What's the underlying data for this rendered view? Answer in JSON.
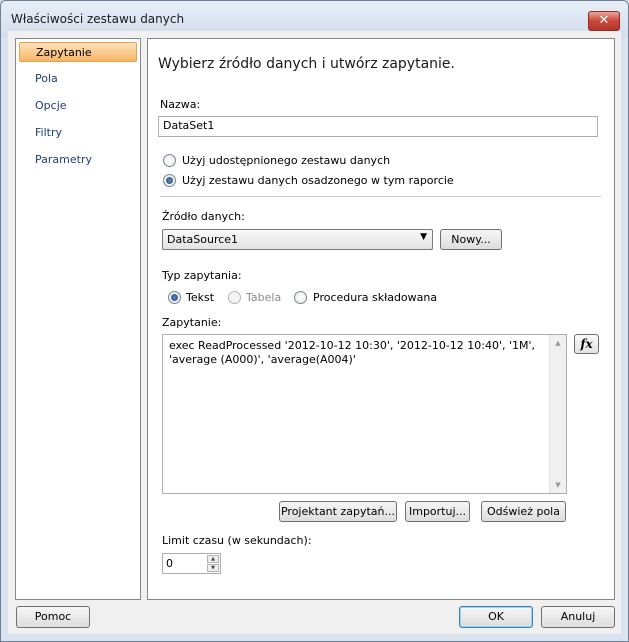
{
  "window": {
    "title": "Właściwości zestawu danych",
    "close_glyph": "✕"
  },
  "nav": {
    "items": [
      {
        "label": "Zapytanie",
        "selected": true
      },
      {
        "label": "Pola",
        "selected": false
      },
      {
        "label": "Opcje",
        "selected": false
      },
      {
        "label": "Filtry",
        "selected": false
      },
      {
        "label": "Parametry",
        "selected": false
      }
    ]
  },
  "main": {
    "heading": "Wybierz źródło danych i utwórz zapytanie.",
    "name_label": "Nazwa:",
    "name_value": "DataSet1",
    "shared_option": "Użyj udostępnionego zestawu danych",
    "embedded_option": "Użyj zestawu danych osadzonego w tym raporcie",
    "source_label": "Źródło danych:",
    "source_value": "DataSource1",
    "new_button": "Nowy...",
    "query_type_label": "Typ zapytania:",
    "type_text": "Tekst",
    "type_table": "Tabela",
    "type_proc": "Procedura składowana",
    "query_label": "Zapytanie:",
    "query_text": "exec ReadProcessed '2012-10-12 10:30', '2012-10-12 10:40', '1M', 'average (A000)', 'average(A004)'",
    "fx_label": "fx",
    "designer_button": "Projektant zapytań...",
    "import_button": "Importuj...",
    "refresh_button": "Odśwież pola",
    "timeout_label": "Limit czasu (w sekundach):",
    "timeout_value": "0"
  },
  "footer": {
    "help_button": "Pomoc",
    "ok_button": "OK",
    "cancel_button": "Anuluj"
  }
}
